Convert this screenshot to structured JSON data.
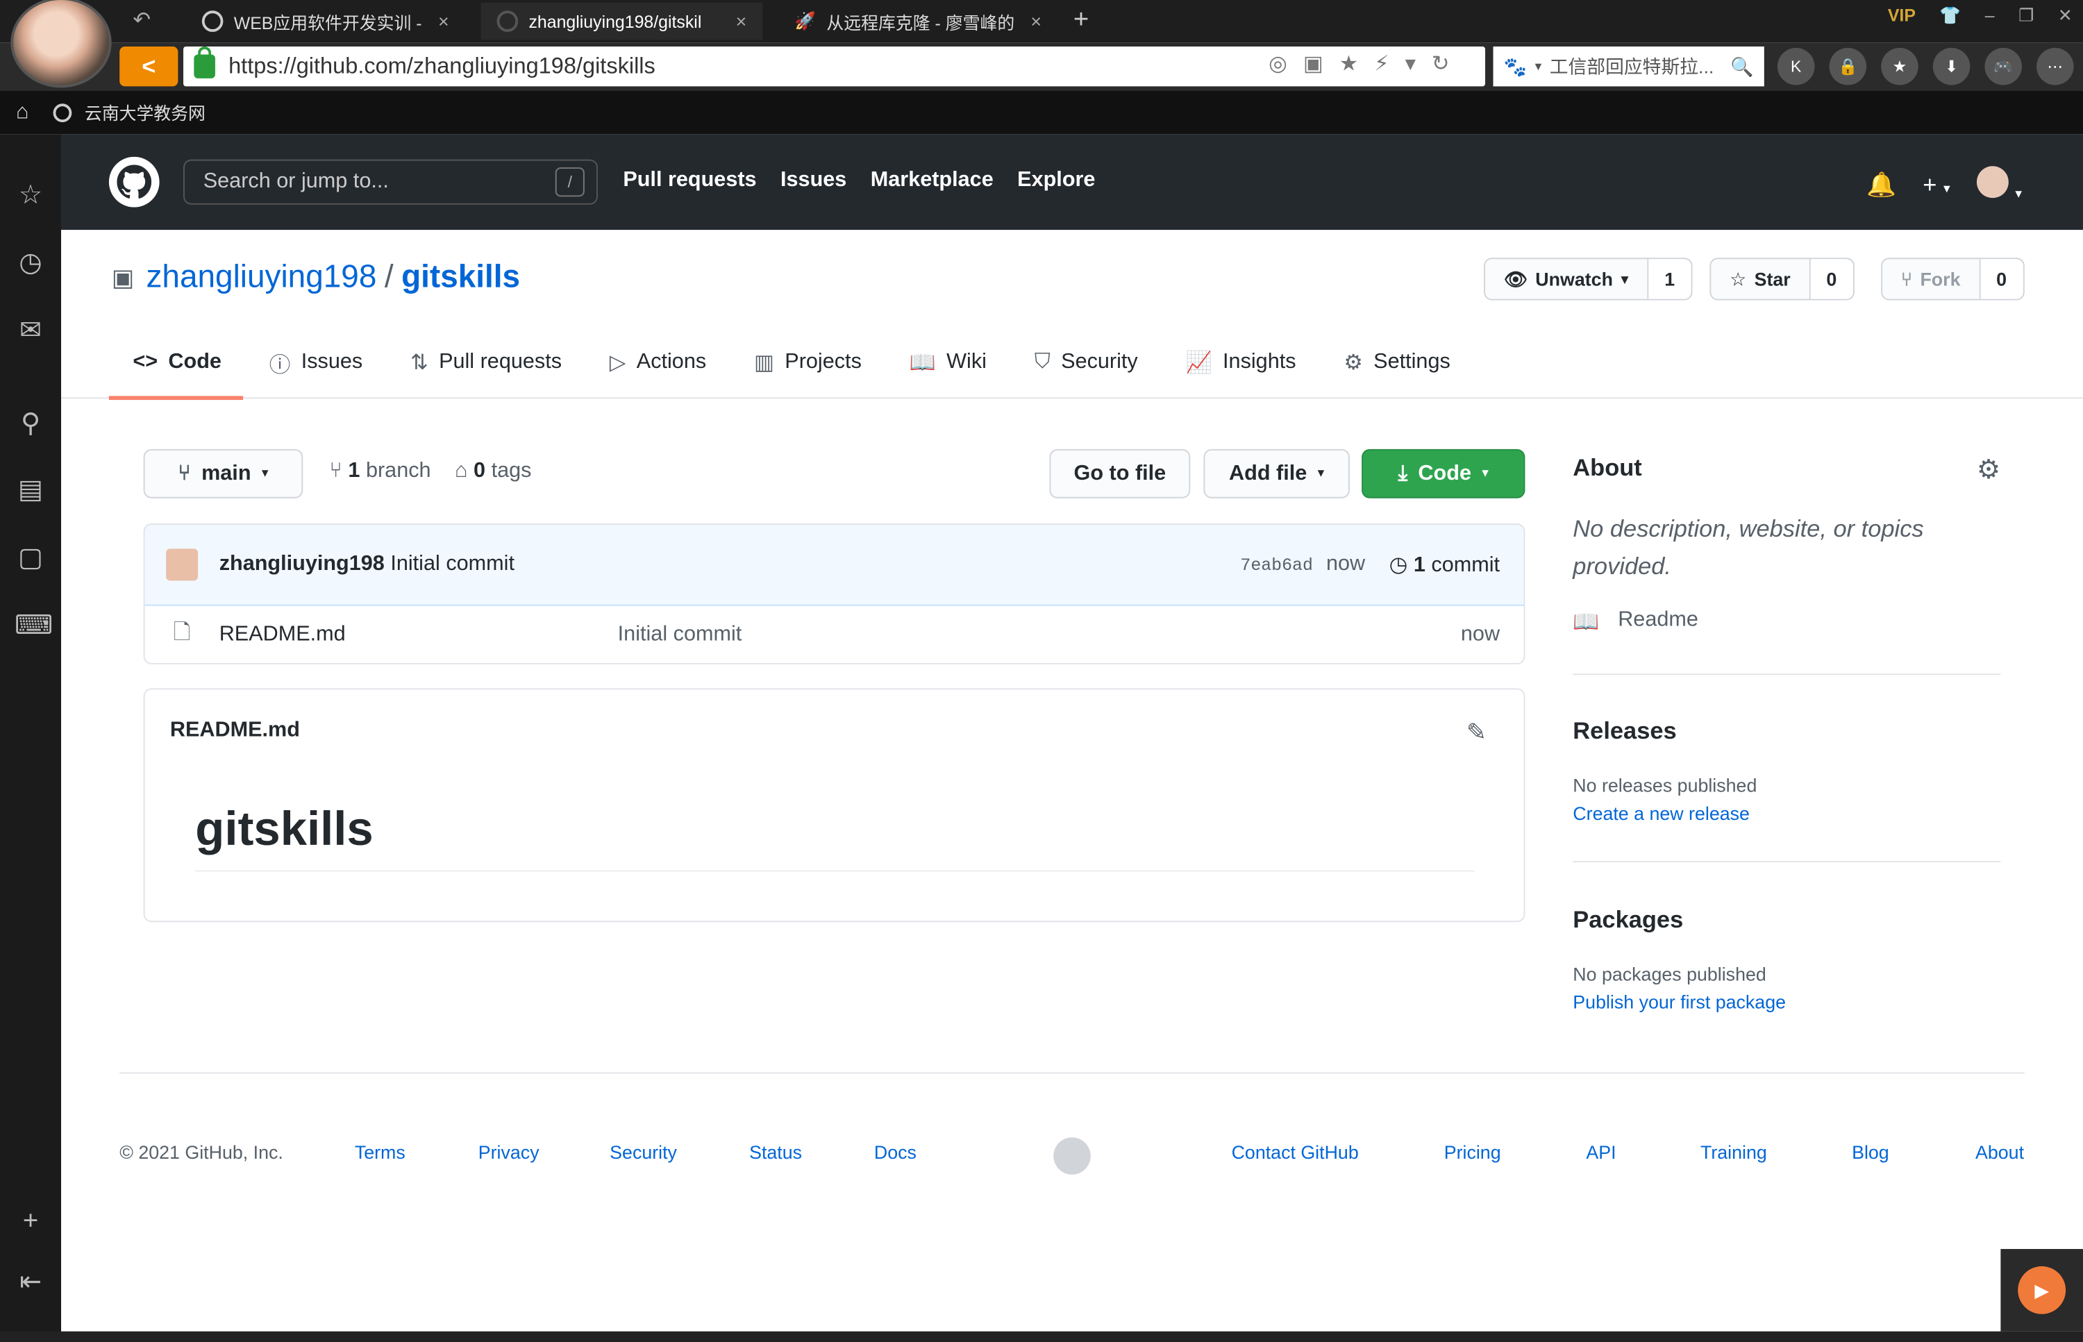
{
  "browser": {
    "tabs": [
      {
        "title": "WEB应用软件开发实训 -",
        "close": "×"
      },
      {
        "title": "zhangliuying198/gitskil",
        "close": "×"
      },
      {
        "title": "从远程库克隆 - 廖雪峰的",
        "close": "×"
      }
    ],
    "new_tab": "+",
    "vip": "VIP",
    "url": "https://github.com/zhangliuying198/gitskills",
    "search_text": "工信部回应特斯拉...",
    "bookmark": "云南大学教务网"
  },
  "gh": {
    "search_placeholder": "Search or jump to...",
    "slash": "/",
    "nav": [
      "Pull requests",
      "Issues",
      "Marketplace",
      "Explore"
    ]
  },
  "repo": {
    "owner": "zhangliuying198",
    "sep": "/",
    "name": "gitskills",
    "unwatch": "Unwatch",
    "watch_count": "1",
    "star": "Star",
    "star_count": "0",
    "fork": "Fork",
    "fork_count": "0",
    "tabs": [
      "Code",
      "Issues",
      "Pull requests",
      "Actions",
      "Projects",
      "Wiki",
      "Security",
      "Insights",
      "Settings"
    ]
  },
  "files": {
    "branch": "main",
    "branch_count": "1",
    "branch_label": "branch",
    "tag_count": "0",
    "tag_label": "tags",
    "go_to_file": "Go to file",
    "add_file": "Add file",
    "code": "Code",
    "commit_author": "zhangliuying198",
    "commit_msg": "Initial commit",
    "commit_sha": "7eab6ad",
    "commit_time": "now",
    "commit_count": "1",
    "commit_label": "commit",
    "rows": [
      {
        "name": "README.md",
        "msg": "Initial commit",
        "time": "now"
      }
    ]
  },
  "readme": {
    "title": "README.md",
    "h1": "gitskills"
  },
  "about": {
    "heading": "About",
    "desc": "No description, website, or topics provided.",
    "readme": "Readme",
    "releases": "Releases",
    "no_releases": "No releases published",
    "create_release": "Create a new release",
    "packages": "Packages",
    "no_packages": "No packages published",
    "publish_package": "Publish your first package"
  },
  "footer": {
    "copyright": "© 2021 GitHub, Inc.",
    "links": [
      "Terms",
      "Privacy",
      "Security",
      "Status",
      "Docs",
      "Contact GitHub",
      "Pricing",
      "API",
      "Training",
      "Blog",
      "About"
    ]
  },
  "colors": {
    "accent": "#0366d6",
    "green": "#2ea44f",
    "tab_underline": "#f9826c",
    "header": "#24292e"
  }
}
